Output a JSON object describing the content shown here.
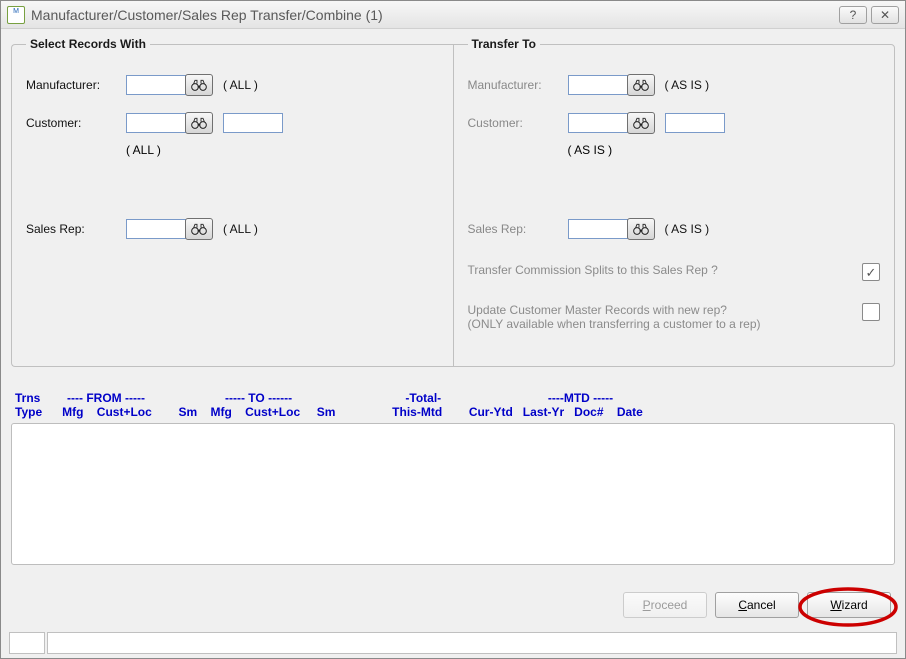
{
  "titlebar": {
    "app_icon_text": "M",
    "title": "Manufacturer/Customer/Sales Rep Transfer/Combine (1)"
  },
  "select": {
    "legend": "Select Records With",
    "mfg_label": "Manufacturer:",
    "mfg_value": "",
    "mfg_suffix": "( ALL )",
    "cust_label": "Customer:",
    "cust_value": "",
    "cust_loc_value": "",
    "cust_note": "( ALL )",
    "rep_label": "Sales Rep:",
    "rep_value": "",
    "rep_suffix": "( ALL )"
  },
  "transfer": {
    "legend": "Transfer To",
    "mfg_label": "Manufacturer:",
    "mfg_value": "",
    "mfg_suffix": "( AS IS )",
    "cust_label": "Customer:",
    "cust_value": "",
    "cust_loc_value": "",
    "cust_note": "( AS IS )",
    "rep_label": "Sales Rep:",
    "rep_value": "",
    "rep_suffix": "( AS IS )",
    "opt1": "Transfer Commission Splits to this Sales Rep ?",
    "opt2_line1": "Update Customer Master Records with new rep?",
    "opt2_line2": "(ONLY available when transferring a customer to a rep)"
  },
  "grid": {
    "header_line1": "Trns        ---- FROM -----                        ----- TO ------                                  -Total-                                ----MTD -----",
    "header_line2": "Type      Mfg    Cust+Loc        Sm    Mfg    Cust+Loc     Sm                 This-Mtd        Cur-Ytd   Last-Yr   Doc#    Date"
  },
  "actions": {
    "proceed": "Proceed",
    "cancel": "Cancel",
    "wizard": "Wizard"
  }
}
